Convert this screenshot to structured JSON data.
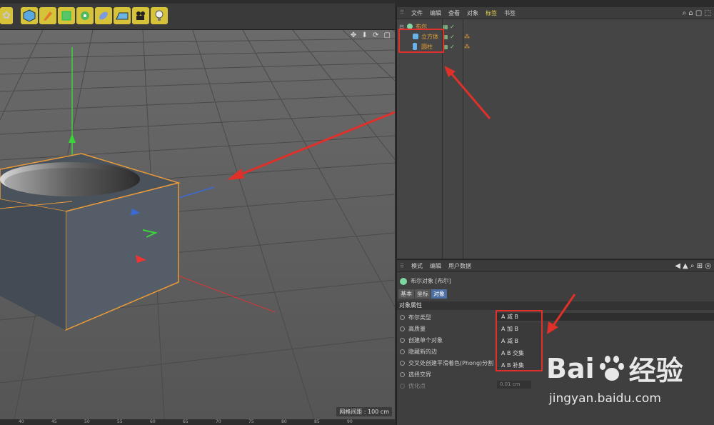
{
  "object_manager": {
    "menu": [
      "文件",
      "编辑",
      "查看",
      "对象",
      "标签",
      "书签"
    ],
    "active_menu": "标签",
    "objects": [
      {
        "name": "布尔",
        "level": 0,
        "icon": "boole-icon"
      },
      {
        "name": "立方体",
        "level": 1,
        "icon": "cube-icon"
      },
      {
        "name": "圆柱",
        "level": 1,
        "icon": "cylinder-icon"
      }
    ]
  },
  "attribute_manager": {
    "menu": [
      "模式",
      "编辑",
      "用户数据"
    ],
    "object_title": "布尔对象 [布尔]",
    "tabs": [
      "基本",
      "坐标",
      "对象"
    ],
    "active_tab": "对象",
    "section_title": "对象属性",
    "properties": [
      {
        "label": "布尔类型"
      },
      {
        "label": "高质量"
      },
      {
        "label": "创建单个对象"
      },
      {
        "label": "隐藏新的边"
      },
      {
        "label": "交叉处创建平滑着色(Phong)分割"
      },
      {
        "label": "选择交界"
      },
      {
        "label": "优化点"
      }
    ],
    "boolean_type_value": "A 减 B",
    "boolean_type_options": [
      "A 加 B",
      "A 减 B",
      "A B 交集",
      "A B 补集"
    ],
    "optimize_value": "0.01 cm"
  },
  "viewport": {
    "grid_spacing": "网格间距 : 100 cm",
    "ruler_ticks": [
      "40",
      "45",
      "50",
      "55",
      "60",
      "65",
      "70",
      "75",
      "80",
      "85",
      "90"
    ]
  },
  "watermark": {
    "brand_left": "Bai",
    "brand_right": "经验",
    "url": "jingyan.baidu.com"
  },
  "colors": {
    "highlight_red": "#e0302a",
    "object_name": "#e5a23a",
    "selection_orange": "#e89a3a",
    "active_tab": "#4d6ea0"
  }
}
